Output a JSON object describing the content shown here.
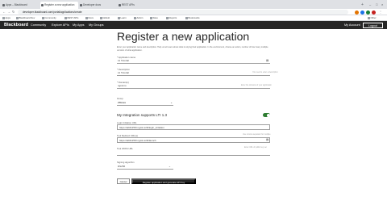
{
  "browser": {
    "tabs": [
      {
        "label": "Apps – Blackboard"
      },
      {
        "label": "Register a new application"
      },
      {
        "label": "Developer docs"
      },
      {
        "label": "REST APIs"
      }
    ],
    "address": "developer.blackboard.com/portal/applications/create"
  },
  "bookmarks": [
    "Apps",
    "Blackboard Dev",
    "Community",
    "REST APIs",
    "Docs",
    "GitHub",
    "Learn",
    "Admin",
    "Sites",
    "Reports",
    "Bookmarks",
    "Other"
  ],
  "site": {
    "logo": "Blackboard",
    "nav": [
      "Community",
      "Explore APIs",
      "My Apps",
      "My Groups"
    ],
    "my_account": "My Account",
    "logout": "Logout"
  },
  "form": {
    "title": "Register a new application",
    "intro": "Enter your application name and description. Help us tell users about what is relying their application. In the environment, choose an action, number of how many multiple versions of what application.",
    "fields": {
      "app_name": {
        "label": "* Application name",
        "value": "Lti Tutorial"
      },
      "description": {
        "label": "* Description",
        "value": "Lti Tutorial",
        "hint": "You need to enter a description"
      },
      "domains": {
        "label": "* Domain(s)",
        "value": "ngrok.io",
        "hint": "Enter the domains of your application"
      },
      "group": {
        "label": "Group",
        "value": "ZMotes"
      }
    },
    "lti_section": "My Integration supports LTI 1.3",
    "lti_fields": {
      "login_url": {
        "label": "Login Initiation URL",
        "value": "https://ab0125f3.ngrok.io/lti/login_initiation"
      },
      "redirect_urls": {
        "label": "Tool Redirect URL(s)",
        "value": "https://ab0125f3.ngrok.io/lti/launch",
        "hint": "Use comma separator for multiple"
      },
      "jwks_url": {
        "label": "Tool JWKS URL",
        "value": "",
        "hint": "Enter URL of public key set"
      },
      "signing_alg": {
        "label": "Signing algorithm",
        "value": "RS256"
      }
    },
    "buttons": {
      "cancel": "Cancel",
      "submit": "Register application and generate API Key"
    }
  }
}
